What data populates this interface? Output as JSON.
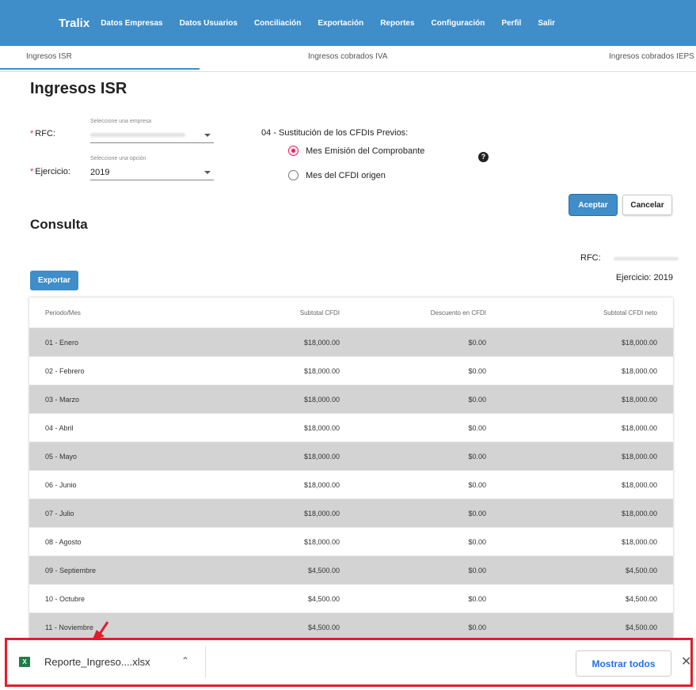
{
  "nav": {
    "brand": "Tralix",
    "links": [
      "Datos Empresas",
      "Datos Usuarios",
      "Conciliación",
      "Exportación",
      "Reportes",
      "Configuración",
      "Perfil",
      "Salir"
    ]
  },
  "tabs": [
    "Ingresos ISR",
    "Ingresos cobrados IVA",
    "Ingresos cobrados IEPS"
  ],
  "page_title": "Ingresos ISR",
  "form": {
    "rfc_label": "RFC:",
    "rfc_hint": "Seleccione una empresa",
    "ejercicio_label": "Ejercicio:",
    "ejercicio_hint": "Seleccione una opción",
    "ejercicio_value": "2019",
    "required_mark": "*",
    "substitution_title": "04 - Sustitución de los CFDIs Previos:",
    "options": [
      "Mes Emisión del Comprobante",
      "Mes del CFDI origen"
    ],
    "selected_option": "Mes Emisión del Comprobante",
    "accept": "Aceptar",
    "cancel": "Cancelar"
  },
  "consulta": {
    "title": "Consulta",
    "export": "Exportar",
    "rfc_label": "RFC:",
    "ejercicio_label": "Ejercicio: 2019"
  },
  "table": {
    "headers": [
      "Periodo/Mes",
      "Subtotal CFDI",
      "Descuento en CFDI",
      "Subtotal CFDI neto"
    ],
    "rows": [
      [
        "01 - Enero",
        "$18,000.00",
        "$0.00",
        "$18,000.00"
      ],
      [
        "02 - Febrero",
        "$18,000.00",
        "$0.00",
        "$18,000.00"
      ],
      [
        "03 - Marzo",
        "$18,000.00",
        "$0.00",
        "$18,000.00"
      ],
      [
        "04 - Abril",
        "$18,000.00",
        "$0.00",
        "$18,000.00"
      ],
      [
        "05 - Mayo",
        "$18,000.00",
        "$0.00",
        "$18,000.00"
      ],
      [
        "06 - Junio",
        "$18,000.00",
        "$0.00",
        "$18,000.00"
      ],
      [
        "07 - Julio",
        "$18,000.00",
        "$0.00",
        "$18,000.00"
      ],
      [
        "08 - Agosto",
        "$18,000.00",
        "$0.00",
        "$18,000.00"
      ],
      [
        "09 - Septiembre",
        "$4,500.00",
        "$0.00",
        "$4,500.00"
      ],
      [
        "10 - Octubre",
        "$4,500.00",
        "$0.00",
        "$4,500.00"
      ],
      [
        "11 - Noviembre",
        "$4,500.00",
        "$0.00",
        "$4,500.00"
      ]
    ]
  },
  "download": {
    "filename": "Reporte_Ingreso....xlsx",
    "show_all": "Mostrar todos",
    "icon": "excel-file-icon",
    "close_icon": "close-icon"
  },
  "colors": {
    "nav_bg": "#3f8dc9",
    "accent_red": "#e31c2b",
    "radio_pink": "#e0245e",
    "row_shade": "#d3d3d3"
  }
}
